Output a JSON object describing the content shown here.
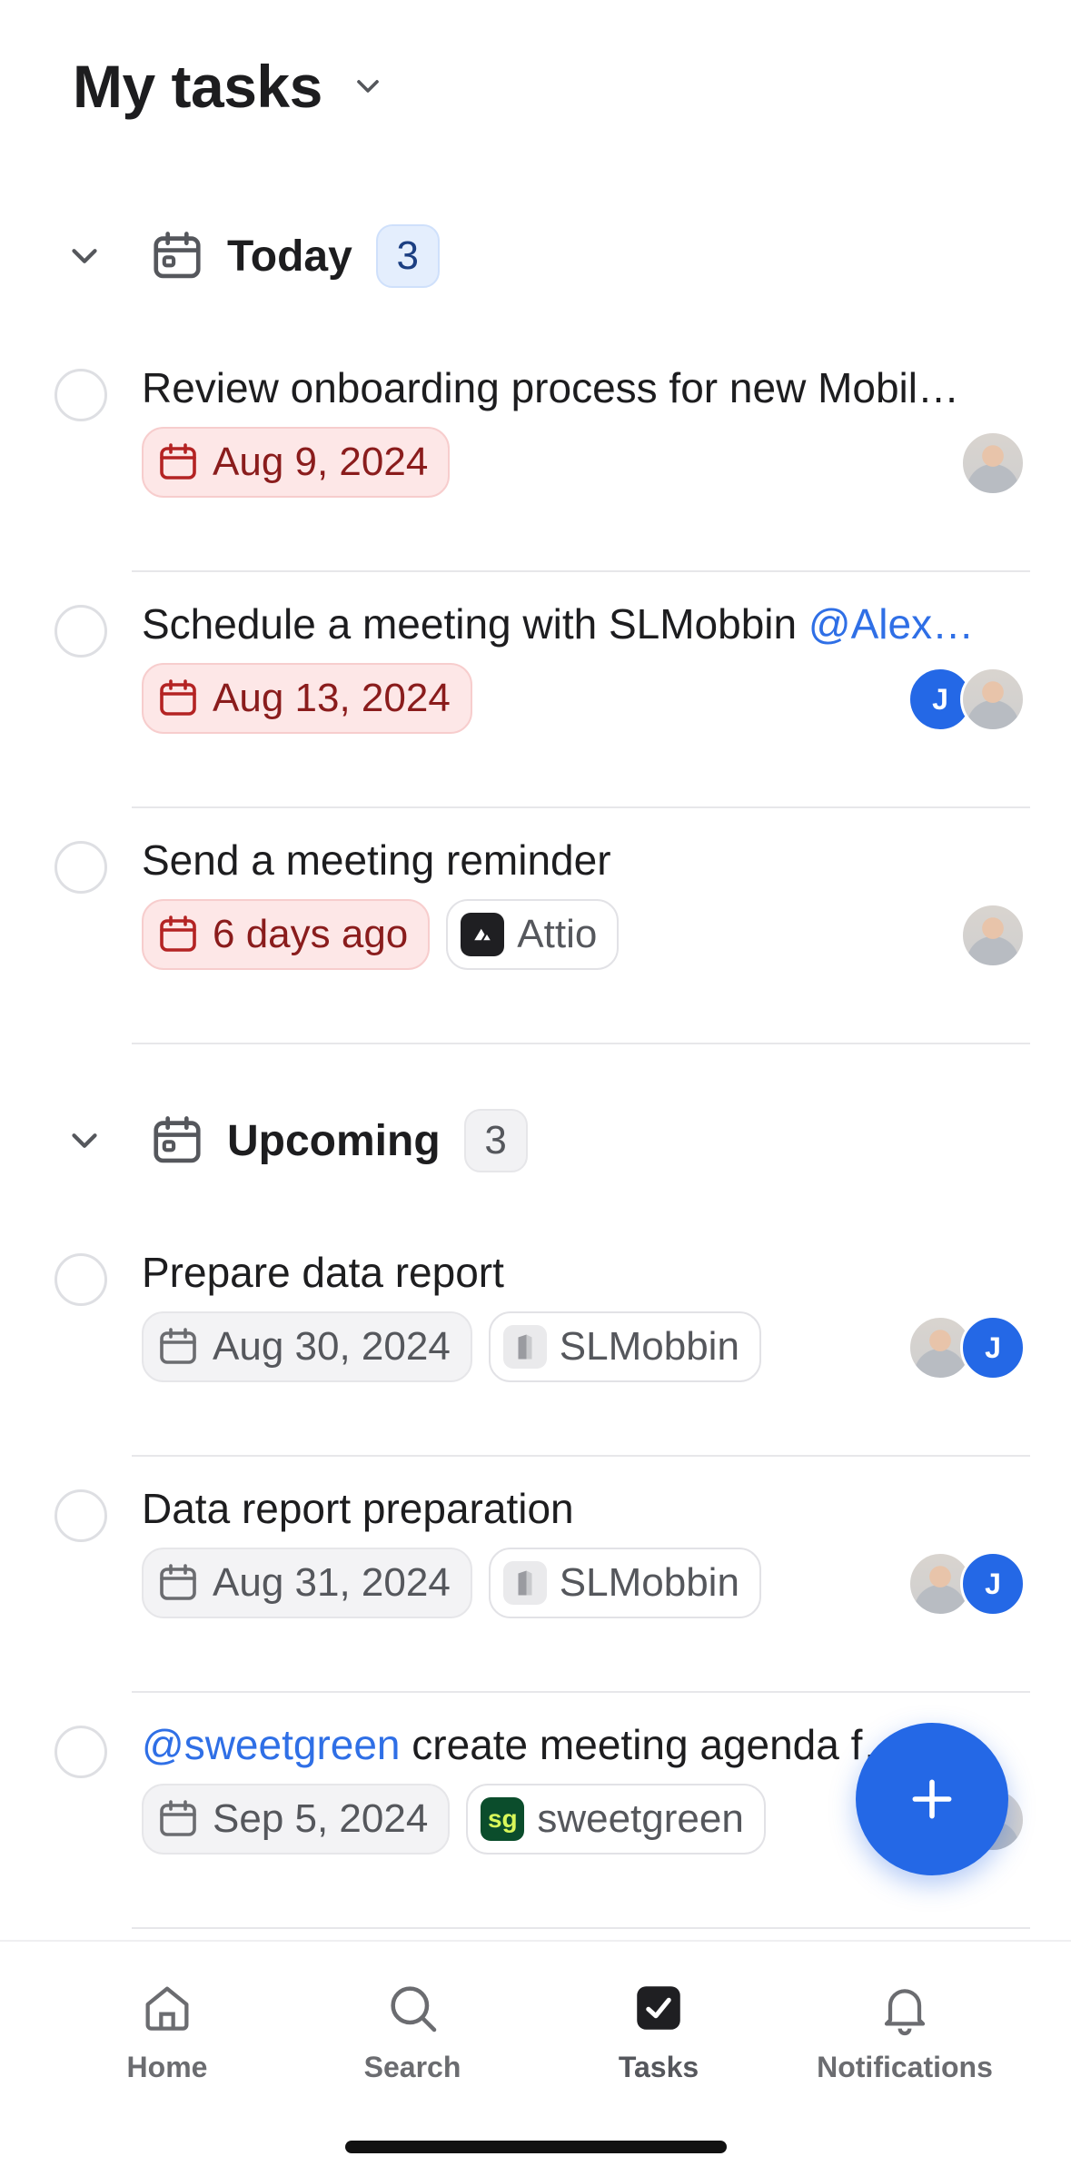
{
  "header": {
    "title": "My tasks"
  },
  "sections": [
    {
      "title": "Today",
      "count": "3",
      "tasks": [
        {
          "title": "Review onboarding process for new Mobil…",
          "date": "Aug 9, 2024"
        },
        {
          "title": "Schedule a meeting with SLMobbin ",
          "mention": "@Alex…",
          "date": "Aug 13, 2024",
          "assignee_initial": "J"
        },
        {
          "title": "Send a meeting reminder",
          "date": "6 days ago",
          "record": "Attio"
        }
      ]
    },
    {
      "title": "Upcoming",
      "count": "3",
      "tasks": [
        {
          "title": "Prepare data report",
          "date": "Aug 30, 2024",
          "record": "SLMobbin",
          "assignee_initial": "J"
        },
        {
          "title": "Data report preparation",
          "date": "Aug 31, 2024",
          "record": "SLMobbin",
          "assignee_initial": "J"
        },
        {
          "mention": "@sweetgreen",
          "title": " create meeting agenda f…",
          "date": "Sep 5, 2024",
          "record": "sweetgreen",
          "record_logo": "sg"
        }
      ]
    }
  ],
  "tabbar": {
    "items": [
      {
        "label": "Home",
        "icon": "home-icon"
      },
      {
        "label": "Search",
        "icon": "search-icon"
      },
      {
        "label": "Tasks",
        "icon": "tasks-check-icon"
      },
      {
        "label": "Notifications",
        "icon": "bell-icon"
      }
    ],
    "active": "Tasks"
  },
  "colors": {
    "accent": "#2468e6",
    "overdue_bg": "#fde7e7",
    "overdue_text": "#8a1c1c",
    "mention": "#2f6fe6"
  }
}
